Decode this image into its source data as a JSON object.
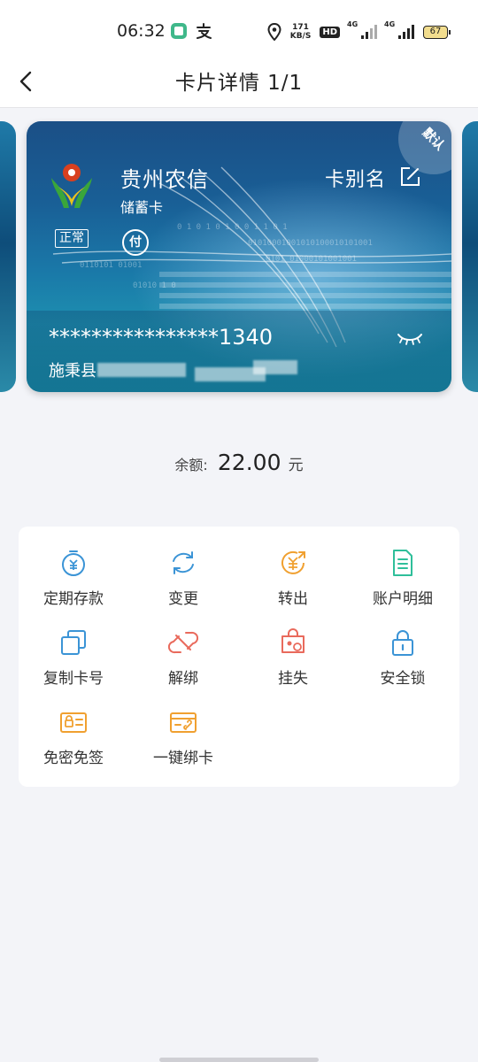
{
  "status_bar": {
    "time": "06:32",
    "net_speed_value": "171",
    "net_speed_unit": "KB/S",
    "hd_label": "HD",
    "signal_1_label": "4G",
    "signal_2_label": "4G",
    "battery_level": "67"
  },
  "nav": {
    "title": "卡片详情 1/1"
  },
  "card": {
    "bank_name": "贵州农信",
    "card_type": "储蓄卡",
    "alias_label": "卡别名",
    "default_label": "默认",
    "status_label": "正常",
    "pay_label": "付",
    "number": "****************1340",
    "holder_visible": "施秉县",
    "colors": {
      "logo_green": "#3aa63a",
      "logo_red": "#d8401f",
      "logo_yellow": "#e8c21c"
    }
  },
  "balance": {
    "label": "余额:",
    "value": "22.00",
    "unit": "元"
  },
  "actions": [
    {
      "label": "定期存款",
      "icon": "time-deposit-icon",
      "color": "#3b94d6"
    },
    {
      "label": "变更",
      "icon": "refresh-icon",
      "color": "#3b94d6"
    },
    {
      "label": "转出",
      "icon": "transfer-out-icon",
      "color": "#f0a030"
    },
    {
      "label": "账户明细",
      "icon": "account-detail-icon",
      "color": "#2fbf9a"
    },
    {
      "label": "复制卡号",
      "icon": "copy-icon",
      "color": "#3b94d6"
    },
    {
      "label": "解绑",
      "icon": "unbind-icon",
      "color": "#e96a5c"
    },
    {
      "label": "挂失",
      "icon": "report-loss-icon",
      "color": "#e96a5c"
    },
    {
      "label": "安全锁",
      "icon": "lock-icon",
      "color": "#3b94d6"
    },
    {
      "label": "免密免签",
      "icon": "password-free-icon",
      "color": "#f0a030"
    },
    {
      "label": "一键绑卡",
      "icon": "quick-bind-card-icon",
      "color": "#f0a030"
    }
  ]
}
